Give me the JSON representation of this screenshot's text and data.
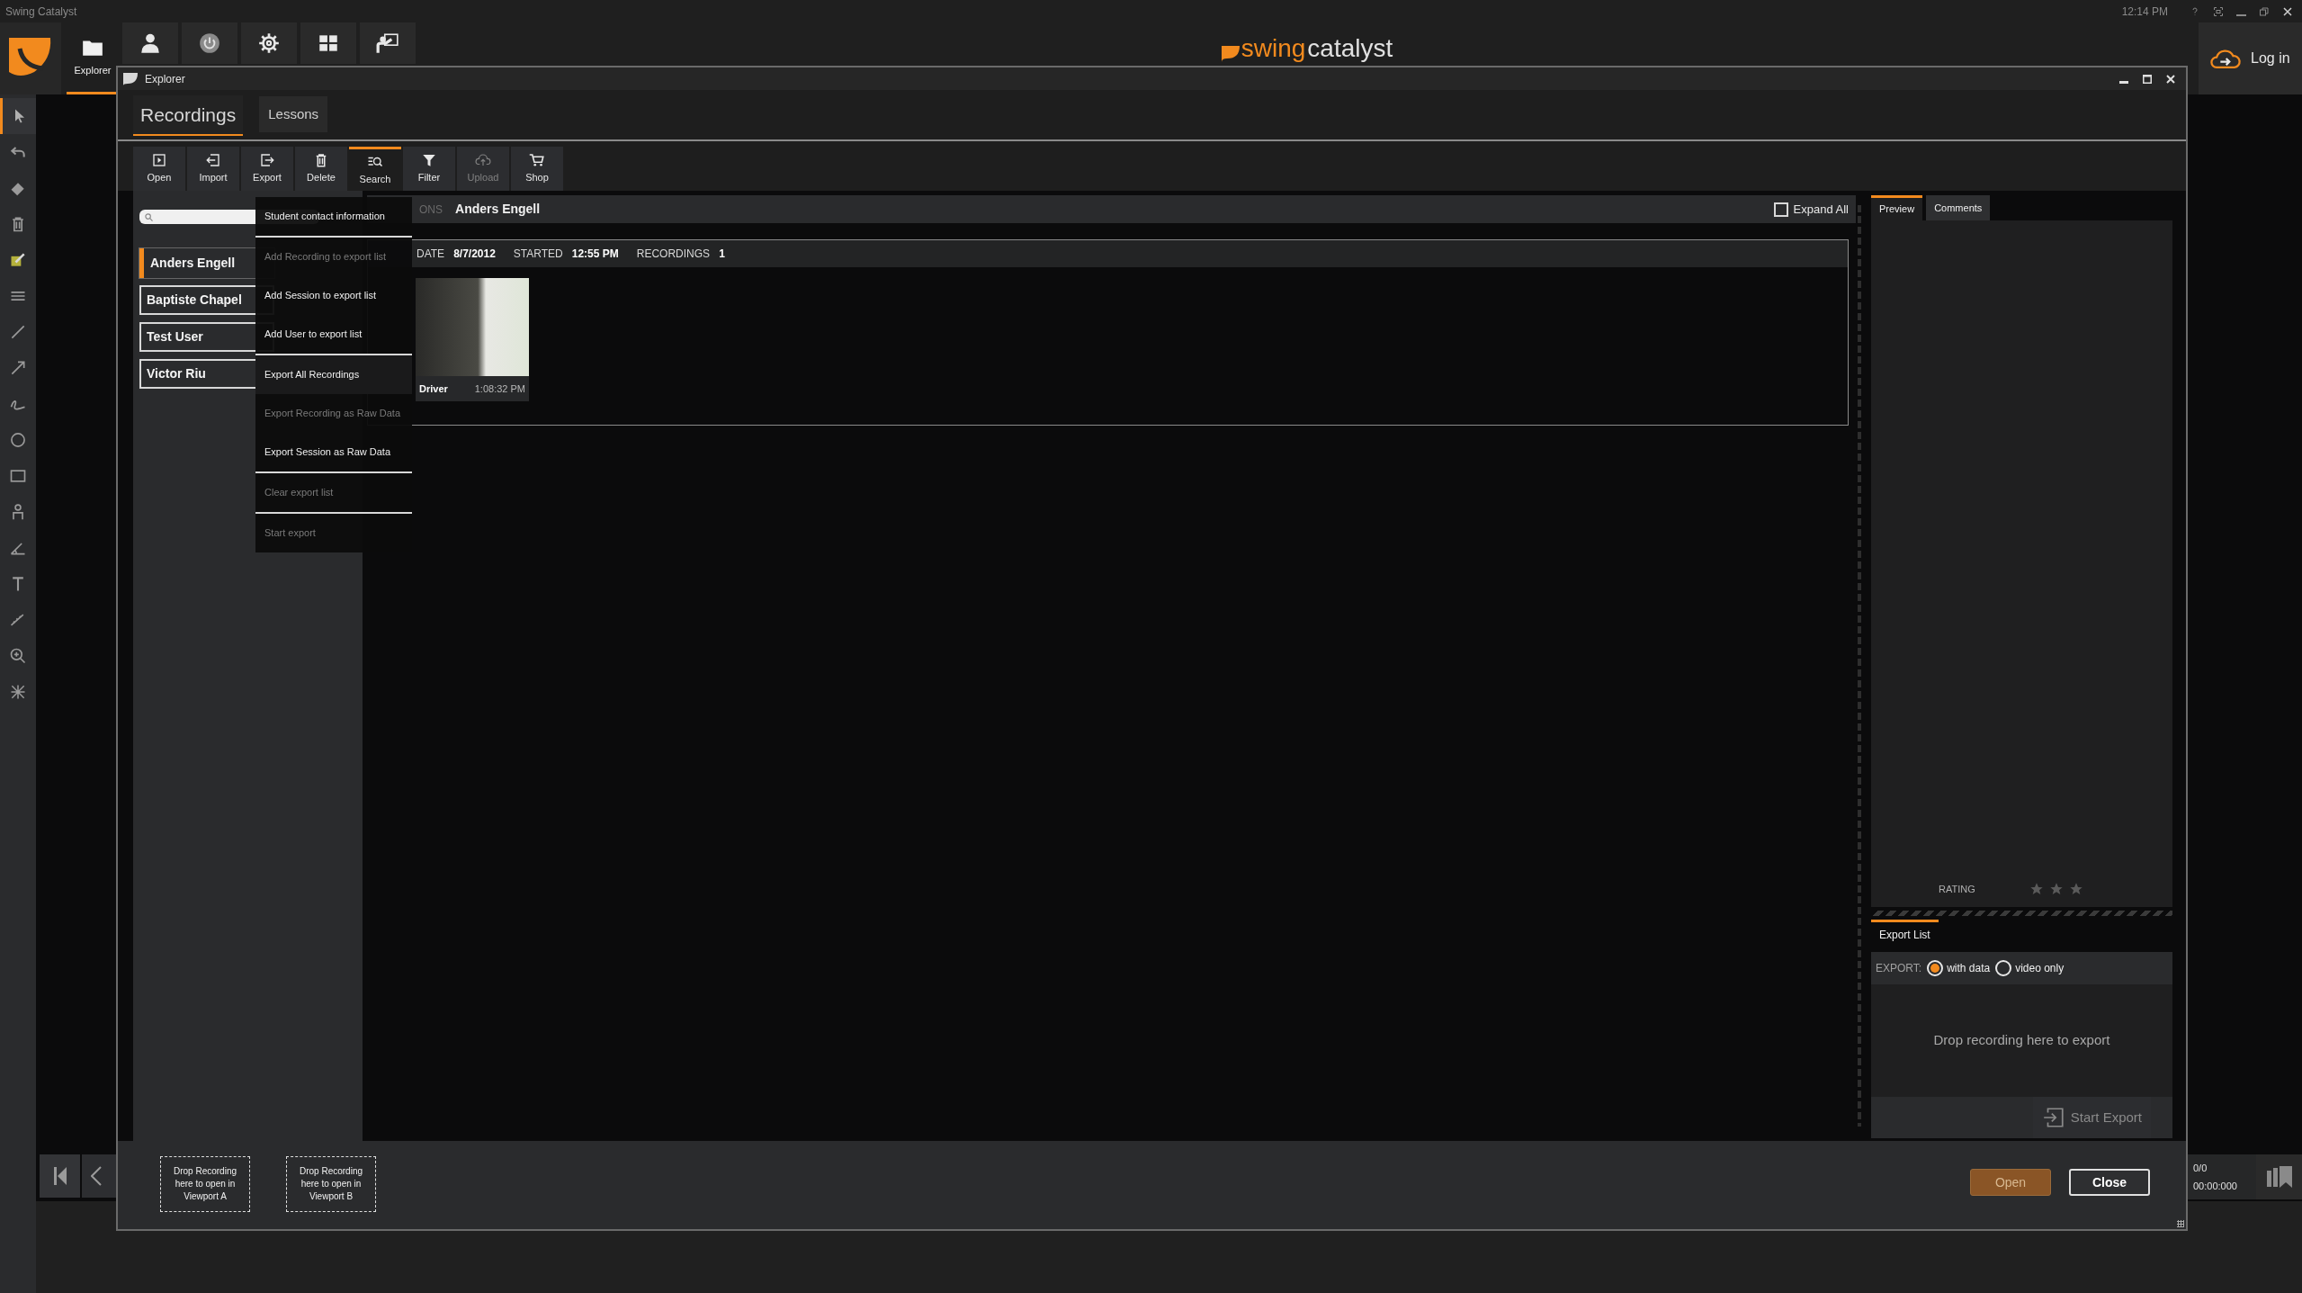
{
  "app": {
    "title": "Swing Catalyst",
    "time": "12:14 PM"
  },
  "nav": [
    {
      "kind": "folder",
      "label": "Explorer",
      "selected": true
    },
    {
      "kind": "person",
      "selected": false
    },
    {
      "kind": "power",
      "selected": false
    },
    {
      "kind": "gear",
      "selected": false
    },
    {
      "kind": "grid",
      "selected": false
    },
    {
      "kind": "coach",
      "selected": false
    }
  ],
  "brand": {
    "part_1": "swing",
    "part_2": "catalyst"
  },
  "login": "Log in",
  "tools": [
    {
      "kind": "pointer",
      "selected": true
    },
    {
      "kind": "undo",
      "selected": false
    },
    {
      "kind": "eraser",
      "selected": false
    },
    {
      "kind": "trash",
      "selected": false
    },
    {
      "kind": "note",
      "selected": false
    },
    {
      "kind": "lines",
      "selected": false
    },
    {
      "kind": "line",
      "selected": false
    },
    {
      "kind": "arrow",
      "selected": false
    },
    {
      "kind": "freehand",
      "selected": false
    },
    {
      "kind": "circle",
      "selected": false
    },
    {
      "kind": "rectangle",
      "selected": false
    },
    {
      "kind": "person",
      "selected": false
    },
    {
      "kind": "angle",
      "selected": false
    },
    {
      "kind": "text",
      "selected": false
    },
    {
      "kind": "ruler",
      "selected": false
    },
    {
      "kind": "zoom",
      "selected": false
    },
    {
      "kind": "grid",
      "selected": false
    }
  ],
  "explorer": {
    "title": "Explorer",
    "tabs": [
      {
        "label": "Recordings",
        "selected": true
      },
      {
        "label": "Lessons",
        "selected": false
      }
    ],
    "toolbar": [
      {
        "kind": "open",
        "label": "Open",
        "selected": false,
        "disabled": false
      },
      {
        "kind": "import",
        "label": "Import",
        "selected": false,
        "disabled": false
      },
      {
        "kind": "export",
        "label": "Export",
        "selected": false,
        "disabled": false
      },
      {
        "kind": "delete",
        "label": "Delete",
        "selected": false,
        "disabled": false
      },
      {
        "kind": "search",
        "label": "Search",
        "selected": true,
        "disabled": false
      },
      {
        "kind": "filter",
        "label": "Filter",
        "selected": false,
        "disabled": false
      },
      {
        "kind": "upload",
        "label": "Upload",
        "selected": false,
        "disabled": true
      },
      {
        "kind": "shop",
        "label": "Shop",
        "selected": false,
        "disabled": false
      }
    ],
    "users": [
      {
        "name": "Anders Engell",
        "selected": true
      },
      {
        "name": "Baptiste Chapel",
        "selected": false
      },
      {
        "name": "Test User",
        "selected": false
      },
      {
        "name": "Victor Riu",
        "selected": false
      }
    ],
    "sessions_header": {
      "label": "ONS",
      "user": "Anders Engell"
    },
    "expand_all": {
      "label": "Expand All",
      "checked": false
    },
    "session": {
      "date_label": "DATE",
      "date": "8/7/2012",
      "started_label": "STARTED",
      "started": "12:55 PM",
      "recordings_label": "RECORDINGS",
      "recordings": "1",
      "items": [
        {
          "name": "Driver",
          "time": "1:08:32 PM"
        }
      ]
    },
    "side_tabs": [
      {
        "label": "Preview",
        "selected": true
      },
      {
        "label": "Comments",
        "selected": false
      }
    ],
    "rating": {
      "label": "RATING",
      "stars": 0
    },
    "export_list": {
      "tab": "Export List",
      "export_label": "EXPORT:",
      "options": [
        {
          "label": "with data",
          "selected": true
        },
        {
          "label": "video only",
          "selected": false
        }
      ],
      "drop_hint": "Drop recording here to export",
      "start": {
        "label": "Start Export",
        "disabled": true
      }
    },
    "drop_zones": [
      "Drop Recording here to open in Viewport A",
      "Drop Recording here to open in Viewport B"
    ],
    "buttons": [
      {
        "kind": "primary",
        "label": "Open"
      },
      {
        "kind": "secondary",
        "label": "Close"
      }
    ]
  },
  "menu": [
    {
      "label": "Student contact information",
      "disabled": false,
      "highlighted": false,
      "separator_after": true
    },
    {
      "label": "Add Recording to export list",
      "disabled": true,
      "highlighted": false,
      "separator_after": false
    },
    {
      "label": "Add Session to export list",
      "disabled": false,
      "highlighted": false,
      "separator_after": false
    },
    {
      "label": "Add User to export list",
      "disabled": false,
      "highlighted": false,
      "separator_after": true
    },
    {
      "label": "Export All Recordings",
      "disabled": false,
      "highlighted": true,
      "separator_after": false
    },
    {
      "label": "Export Recording as Raw Data",
      "disabled": true,
      "highlighted": false,
      "separator_after": false
    },
    {
      "label": "Export Session as Raw Data",
      "disabled": false,
      "highlighted": false,
      "separator_after": true
    },
    {
      "label": "Clear export list",
      "disabled": true,
      "highlighted": false,
      "separator_after": true
    },
    {
      "label": "Start export",
      "disabled": true,
      "highlighted": false,
      "separator_after": false
    }
  ],
  "playback": {
    "counter": "0/0",
    "time": "00:00:000"
  }
}
